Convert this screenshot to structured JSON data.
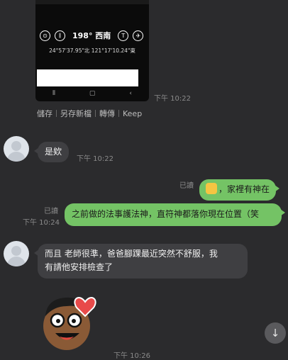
{
  "image_message": {
    "heading": "198° 西南",
    "coords": "24°57'37.95\"北  121°17'10.24\"東",
    "time": "下午 10:22"
  },
  "actions": [
    "儲存",
    "另存新檔",
    "轉傳",
    "Keep"
  ],
  "messages": [
    {
      "text": "是欸",
      "time": "下午 10:22"
    },
    {
      "text": "家裡有神在",
      "read": "已讀"
    },
    {
      "text": "之前做的法事護法神，直符神都落你現在位置（笑",
      "read": "已讀",
      "time": "下午 10:24"
    },
    {
      "line1": "而且 老師很準，爸爸腳踝最近突然不舒服，我",
      "line2": "有請他安排檢查了"
    }
  ],
  "bottom_time": "下午 10:26",
  "icons": {
    "scroll_down": "↓",
    "location_icon": "⊙",
    "pause_icon": "⏸",
    "t_icon": "T",
    "pin_icon": "✈"
  }
}
